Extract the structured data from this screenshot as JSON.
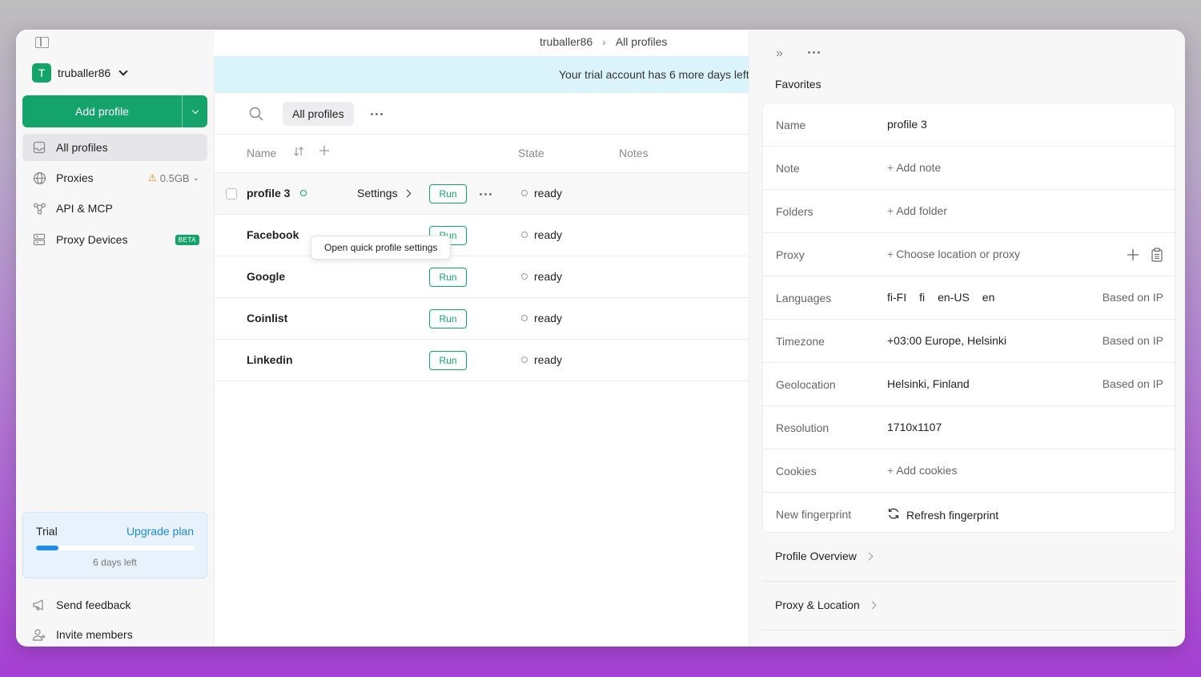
{
  "breadcrumb": {
    "account": "truballer86",
    "current": "All profiles"
  },
  "sidebar": {
    "account_initial": "T",
    "account_name": "truballer86",
    "add_profile_label": "Add profile",
    "items": [
      {
        "label": "All profiles",
        "icon": "inbox-icon"
      },
      {
        "label": "Proxies",
        "icon": "globe-icon",
        "extra": "0.5GB"
      },
      {
        "label": "API & MCP",
        "icon": "api-icon"
      },
      {
        "label": "Proxy Devices",
        "icon": "server-icon",
        "badge": "BETA"
      }
    ],
    "trial": {
      "title": "Trial",
      "upgrade_label": "Upgrade plan",
      "days_left": "6 days left",
      "progress": 0.14
    },
    "bottom": [
      {
        "label": "Send feedback",
        "icon": "megaphone-icon"
      },
      {
        "label": "Invite members",
        "icon": "user-plus-icon"
      }
    ]
  },
  "main": {
    "banner": "Your trial account has 6 more days left",
    "filter_label": "All profiles",
    "columns": {
      "name": "Name",
      "state": "State",
      "notes": "Notes"
    },
    "rows": [
      {
        "name": "profile 3",
        "run": "Run",
        "state": "ready",
        "settings": "Settings"
      },
      {
        "name": "Facebook",
        "run": "Run",
        "state": "ready"
      },
      {
        "name": "Google",
        "run": "Run",
        "state": "ready"
      },
      {
        "name": "Coinlist",
        "run": "Run",
        "state": "ready"
      },
      {
        "name": "Linkedin",
        "run": "Run",
        "state": "ready"
      }
    ],
    "tooltip": "Open quick profile settings"
  },
  "panel": {
    "title": "Favorites",
    "fields": {
      "name": {
        "label": "Name",
        "value": "profile 3"
      },
      "note": {
        "label": "Note",
        "value": "Add note"
      },
      "folders": {
        "label": "Folders",
        "value": "Add folder"
      },
      "proxy": {
        "label": "Proxy",
        "value": "Choose location or proxy"
      },
      "languages": {
        "label": "Languages",
        "values": [
          "fi-FI",
          "fi",
          "en-US",
          "en"
        ],
        "hint": "Based on IP"
      },
      "timezone": {
        "label": "Timezone",
        "value": "+03:00 Europe, Helsinki",
        "hint": "Based on IP"
      },
      "geolocation": {
        "label": "Geolocation",
        "value": "Helsinki, Finland",
        "hint": "Based on IP"
      },
      "resolution": {
        "label": "Resolution",
        "value": "1710x1107"
      },
      "cookies": {
        "label": "Cookies",
        "value": "Add cookies"
      },
      "fingerprint": {
        "label": "New fingerprint",
        "value": "Refresh fingerprint"
      }
    },
    "sections": [
      "Profile Overview",
      "Proxy & Location"
    ]
  },
  "colors": {
    "accent": "#14a36b",
    "link": "#1d8bd9",
    "banner": "#dbf4fc"
  }
}
